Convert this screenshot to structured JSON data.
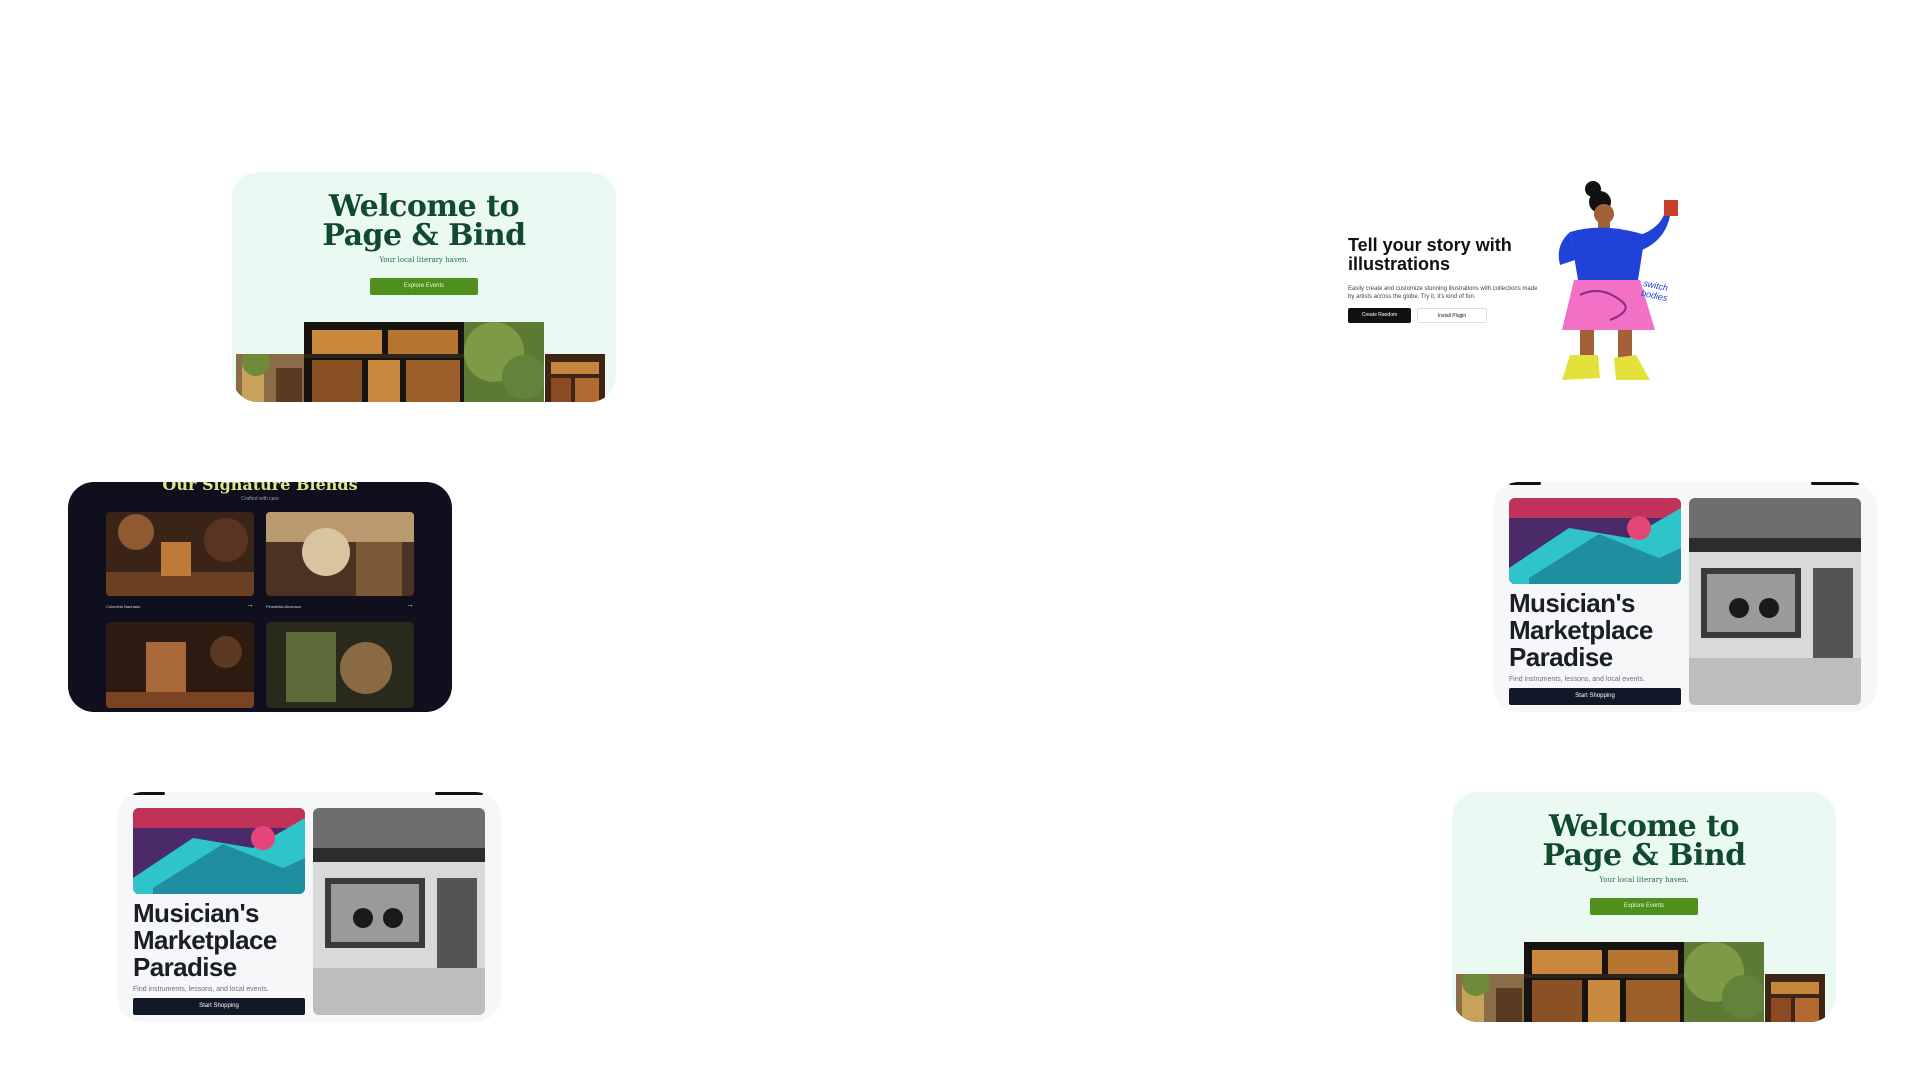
{
  "page_bind": {
    "title_line1": "Welcome to",
    "title_line2": "Page & Bind",
    "subtitle": "Your local literary haven.",
    "button": "Explore Events"
  },
  "coffee": {
    "title": "Our Signature Blends",
    "subtitle": "Crafted with care",
    "items": [
      {
        "label": "Colombia Narinado"
      },
      {
        "label": "Pinealetia Alcohaso"
      }
    ]
  },
  "musician": {
    "title_line1": "Musician's",
    "title_line2": "Marketplace",
    "title_line3": "Paradise",
    "subtitle": "Find instruments, lessons, and local events.",
    "button": "Start Shopping"
  },
  "illustration": {
    "title": "Tell your story with illustrations",
    "description": "Easily create and customize stunning illustrations with collections made by artists across the globe. Try it, it's kind of fun.",
    "button_primary": "Create Random",
    "button_secondary": "Install Plugin",
    "handwritten_note": "switch bodies"
  }
}
